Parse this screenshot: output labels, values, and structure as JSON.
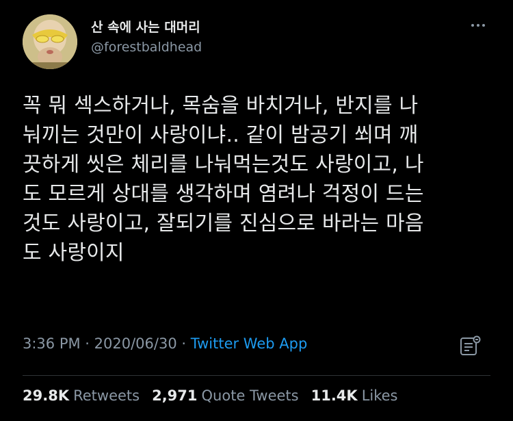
{
  "author": {
    "display_name": "산 속에 사는 대머리",
    "handle": "@forestbaldhead"
  },
  "tweet": {
    "lines": [
      "꼭 뭐 섹스하거나, 목숨을 바치거나, 반지를 나",
      "눠끼는 것만이 사랑이냐.. 같이 밤공기 쐬며 깨",
      "끗하게 씻은 체리를 나눠먹는것도 사랑이고, 나",
      "도 모르게 상대를 생각하며 염려나 걱정이 드는",
      "것도 사랑이고, 잘되기를 진심으로 바라는 마음",
      "도 사랑이지"
    ]
  },
  "meta": {
    "time": "3:36 PM",
    "separator": " · ",
    "date": "2020/06/30",
    "source": "Twitter Web App"
  },
  "stats": {
    "retweets_count": "29.8K",
    "retweets_label": "Retweets",
    "quotes_count": "2,971",
    "quotes_label": "Quote Tweets",
    "likes_count": "11.4K",
    "likes_label": "Likes"
  },
  "icons": {
    "more": "more-icon",
    "analytics": "analytics-icon"
  },
  "colors": {
    "background": "#000000",
    "text": "#e7e9ea",
    "secondary": "#8b98a5",
    "link": "#1d9bf0",
    "divider": "#2f3336"
  }
}
